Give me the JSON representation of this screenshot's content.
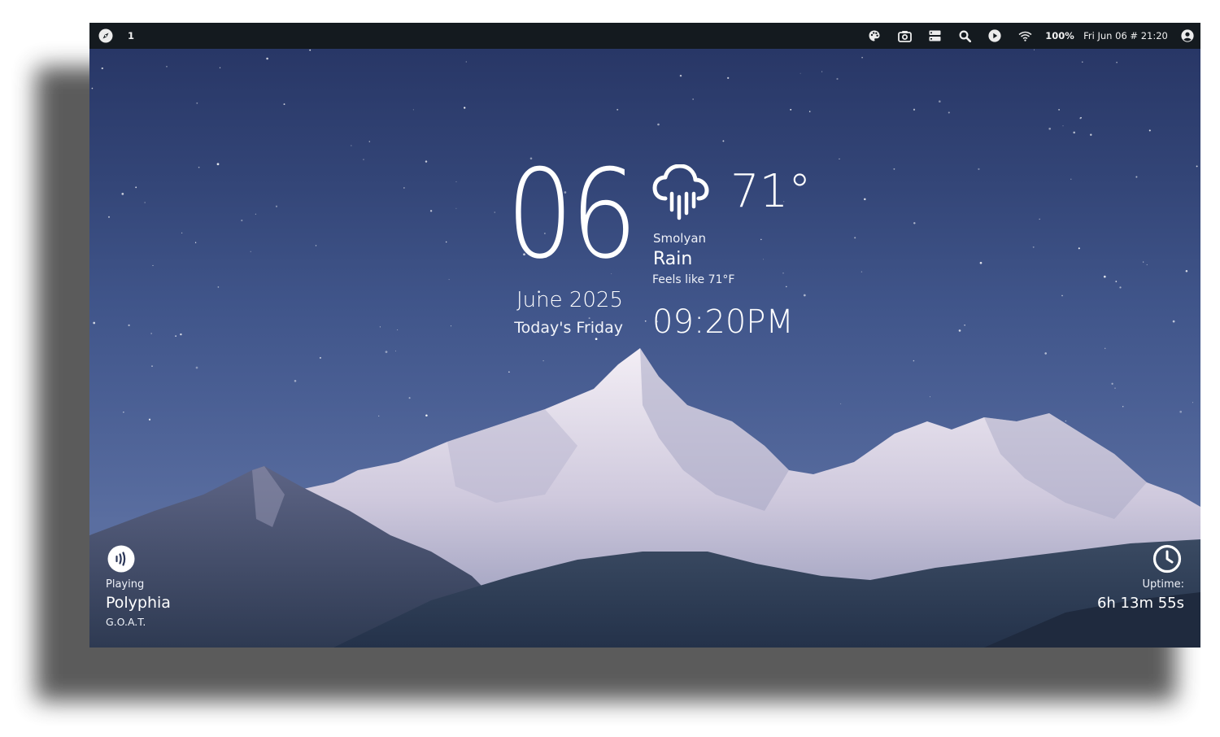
{
  "topbar": {
    "workspace": "1",
    "battery": "100%",
    "datetime": "Fri Jun 06 # 21:20",
    "icons": [
      "compass-icon",
      "palette-icon",
      "camera-icon",
      "server-icon",
      "search-icon",
      "play-icon",
      "wifi-icon",
      "user-icon"
    ]
  },
  "widget": {
    "day": "06",
    "month_year": "June 2025",
    "weekday": "Today's Friday",
    "temperature": "71°",
    "city": "Smolyan",
    "condition": "Rain",
    "feels_like": "Feels like 71°F",
    "time": "09:20PM",
    "weather_icon": "rain-cloud-icon"
  },
  "music": {
    "status": "Playing",
    "artist": "Polyphia",
    "title": "G.O.A.T.",
    "icon": "sound-wave-icon"
  },
  "uptime": {
    "label": "Uptime:",
    "value": "6h 13m 55s",
    "icon": "clock-icon"
  },
  "colors": {
    "bar": "#141a1f",
    "sky_top": "#263463",
    "sky_bottom": "#5e709c",
    "text": "#ffffff"
  }
}
